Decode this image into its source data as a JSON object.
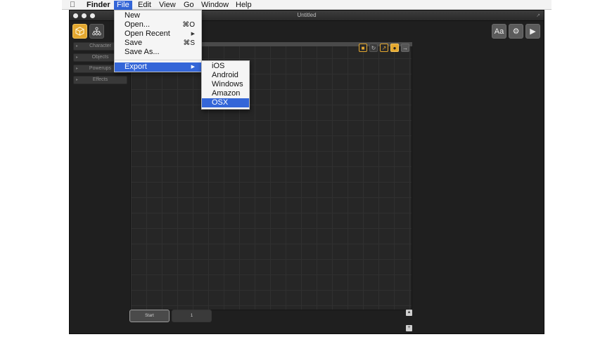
{
  "menubar": {
    "app_name": "Finder",
    "menus": [
      "File",
      "Edit",
      "View",
      "Go",
      "Window",
      "Help"
    ]
  },
  "window": {
    "title": "Untitled"
  },
  "sidebar": {
    "items": [
      {
        "label": "Character"
      },
      {
        "label": "Objects"
      },
      {
        "label": "Powerups"
      },
      {
        "label": "Effects"
      }
    ]
  },
  "toolbar": {
    "font_button_label": "Aa"
  },
  "levels": {
    "start_label": "Start",
    "level_1_label": "1"
  },
  "file_menu": {
    "items": [
      {
        "label": "New",
        "shortcut": ""
      },
      {
        "label": "Open...",
        "shortcut": "⌘O"
      },
      {
        "label": "Open Recent",
        "shortcut": ""
      },
      {
        "label": "Save",
        "shortcut": "⌘S"
      },
      {
        "label": "Save As...",
        "shortcut": ""
      },
      {
        "label": "Export",
        "shortcut": ""
      }
    ]
  },
  "export_menu": {
    "items": [
      {
        "label": "iOS"
      },
      {
        "label": "Android"
      },
      {
        "label": "Windows"
      },
      {
        "label": "Amazon"
      },
      {
        "label": "OSX"
      }
    ]
  },
  "colors": {
    "accent_yellow": "#e3a72f",
    "menu_highlight": "#3466d8",
    "window_bg": "#1f1f1f"
  },
  "icons": {
    "apple": "apple-logo-icon",
    "objects_tool": "cube-icon",
    "hierarchy_tool": "hierarchy-icon",
    "settings": "gear-icon",
    "play": "play-icon"
  }
}
